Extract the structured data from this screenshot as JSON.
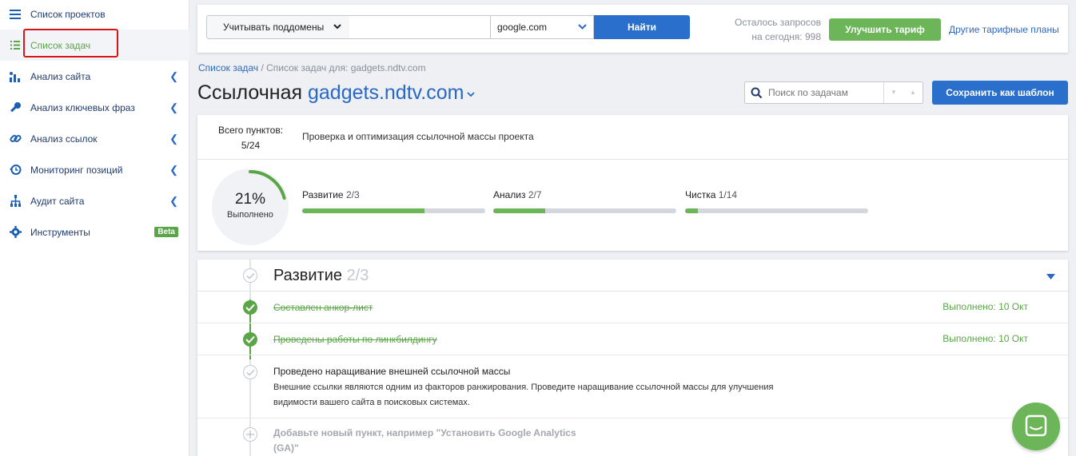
{
  "sidebar": {
    "items": [
      {
        "label": "Список проектов",
        "icon": "menu-icon"
      },
      {
        "label": "Список задач",
        "icon": "list-icon",
        "active": true
      },
      {
        "label": "Анализ сайта",
        "icon": "chart-icon"
      },
      {
        "label": "Анализ ключевых фраз",
        "icon": "key-icon"
      },
      {
        "label": "Анализ ссылок",
        "icon": "link-icon"
      },
      {
        "label": "Мониторинг позиций",
        "icon": "history-icon"
      },
      {
        "label": "Аудит сайта",
        "icon": "sitemap-icon"
      },
      {
        "label": "Инструменты",
        "icon": "gear-icon",
        "badge": "Beta"
      }
    ]
  },
  "topbar": {
    "subdomain_label": "Учитывать поддомены",
    "url_placeholder": "",
    "engine_value": "google.com",
    "find_label": "Найти",
    "quota_line1": "Осталось запросов",
    "quota_line2": "на сегодня: 998",
    "upgrade_label": "Улучшить тариф",
    "other_plans_label": "Другие тарифные планы"
  },
  "breadcrumb": {
    "link": "Список задач",
    "separator": " / ",
    "current": "Список задач для: gadgets.ndtv.com"
  },
  "page": {
    "title_prefix": "Ссылочная",
    "domain": "gadgets.ndtv.com",
    "search_placeholder": "Поиск по задачам",
    "save_template_label": "Сохранить как шаблон"
  },
  "summary": {
    "total_label": "Всего пунктов:",
    "total_value": "5/24",
    "description": "Проверка и оптимизация ссылочной массы проекта",
    "percent_text": "21%",
    "percent_fraction": 0.21,
    "done_label": "Выполнено",
    "categories": [
      {
        "label": "Развитие",
        "count": "2/3",
        "fraction": 0.667
      },
      {
        "label": "Анализ",
        "count": "2/7",
        "fraction": 0.286
      },
      {
        "label": "Чистка",
        "count": "1/14",
        "fraction": 0.071
      }
    ]
  },
  "section": {
    "title": "Развитие",
    "count": "2/3",
    "tasks": [
      {
        "title": "Составлен анкор-лист",
        "done": true,
        "status": "Выполнено: 10 Окт"
      },
      {
        "title": "Проведены работы по линкбилдингу",
        "done": true,
        "status": "Выполнено: 10 Окт"
      },
      {
        "title": "Проведено наращивание внешней ссылочной массы",
        "done": false,
        "description": "Внешние ссылки являются одним из факторов ранжирования. Проведите наращивание ссылочной массы для улучшения видимости вашего сайта в поисковых системах."
      }
    ],
    "add_item_text": "Добавьте новый пункт, например \"Установить Google Analytics (GA)\""
  },
  "colors": {
    "accent_blue": "#2a6fcc",
    "accent_green": "#5aa547",
    "highlight_red": "#d7161c"
  }
}
